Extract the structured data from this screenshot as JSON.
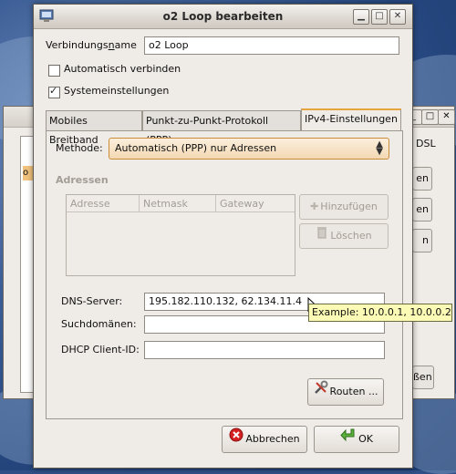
{
  "dialog": {
    "title": "o2 Loop bearbeiten",
    "connection_name_label_pre": "Verbindungs",
    "connection_name_label_u": "n",
    "connection_name_label_post": "ame",
    "connection_name_value": "o2 Loop",
    "auto_connect_label": "Automatisch verbinden",
    "auto_connect_checked": false,
    "system_settings_label": "Systemeinstellungen",
    "system_settings_checked": true
  },
  "tabs": [
    {
      "label": "Mobiles Breitband",
      "active": false
    },
    {
      "label": "Punkt-zu-Punkt-Protokoll (PPP)",
      "active": false
    },
    {
      "label": "IPv4-Einstellungen",
      "active": true
    }
  ],
  "ipv4": {
    "method_label": "Methode:",
    "method_value": "Automatisch (PPP) nur Adressen",
    "addresses_heading": "Adressen",
    "columns": [
      "Adresse",
      "Netmask",
      "Gateway"
    ],
    "add_button": "Hinzufügen",
    "delete_button": "Löschen",
    "dns_label": "DNS-Server:",
    "dns_value": "195.182.110.132, 62.134.11.4",
    "search_domains_label": "Suchdomänen:",
    "search_domains_value": "",
    "dhcp_label": "DHCP Client-ID:",
    "dhcp_value": "",
    "routes_button": "Routen ..."
  },
  "footer": {
    "cancel_button": "Abbrechen",
    "ok_button": "OK"
  },
  "tooltip": {
    "text": "Example: 10.0.0.1, 10.0.0.2"
  },
  "background_window": {
    "partial_labels": [
      "DSL",
      "en",
      "en",
      "n",
      "ßen",
      "o"
    ]
  }
}
